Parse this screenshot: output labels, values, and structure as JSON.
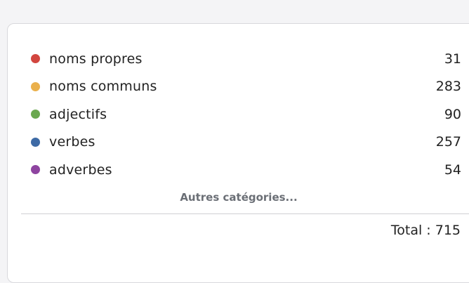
{
  "categories": [
    {
      "label": "noms propres",
      "count": "31",
      "color": "#d2463f",
      "icon": "red-dot-icon"
    },
    {
      "label": "noms communs",
      "count": "283",
      "color": "#eab04c",
      "icon": "orange-dot-icon"
    },
    {
      "label": "adjectifs",
      "count": "90",
      "color": "#6aa84f",
      "icon": "green-dot-icon"
    },
    {
      "label": "verbes",
      "count": "257",
      "color": "#3d6aa5",
      "icon": "blue-dot-icon"
    },
    {
      "label": "adverbes",
      "count": "54",
      "color": "#8e44a0",
      "icon": "purple-dot-icon"
    }
  ],
  "more_link": "Autres catégories...",
  "total_text": "Total : 715"
}
